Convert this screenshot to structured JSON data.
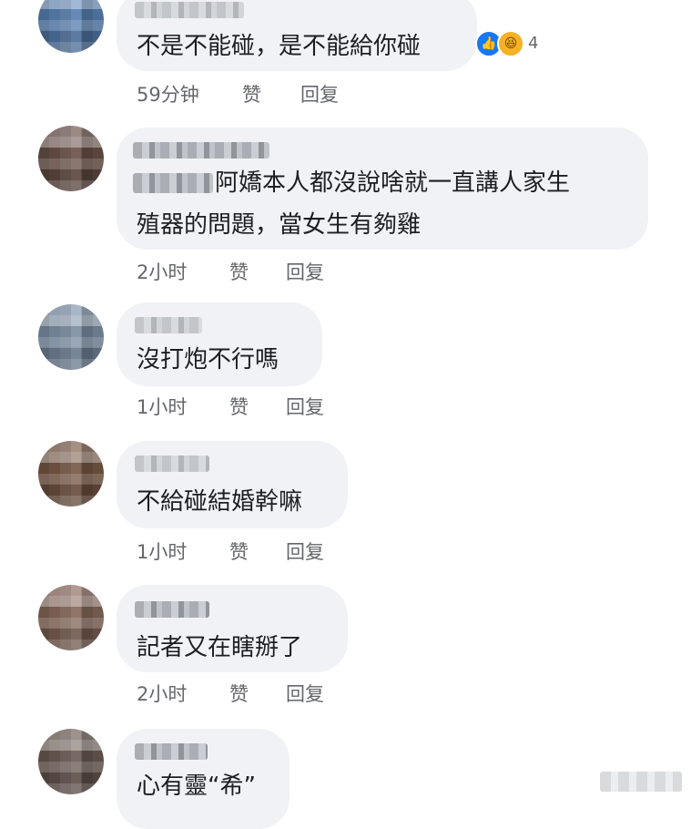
{
  "colors": {
    "bubble": "#f0f2f5",
    "meta_text": "#65676b",
    "like": "#1877f2",
    "haha": "#f7b125"
  },
  "comments": [
    {
      "text_lines": [
        "不是不能碰，是不能給你碰"
      ],
      "time": "59分钟",
      "like_label": "赞",
      "reply_label": "回复",
      "reactions": {
        "icons": [
          "like-icon",
          "haha-icon"
        ],
        "count": "4"
      }
    },
    {
      "text_lines": [
        "阿嬌本人都沒說啥就一直講人家生",
        "殖器的問題，當女生有夠雞"
      ],
      "time": "2小时",
      "like_label": "赞",
      "reply_label": "回复"
    },
    {
      "text_lines": [
        "沒打炮不行嗎"
      ],
      "time": "1小时",
      "like_label": "赞",
      "reply_label": "回复"
    },
    {
      "text_lines": [
        "不給碰結婚幹嘛"
      ],
      "time": "1小时",
      "like_label": "赞",
      "reply_label": "回复"
    },
    {
      "text_lines": [
        "記者又在瞎掰了"
      ],
      "time": "2小时",
      "like_label": "赞",
      "reply_label": "回复"
    },
    {
      "text_lines": [
        "心有靈“希”"
      ]
    }
  ]
}
